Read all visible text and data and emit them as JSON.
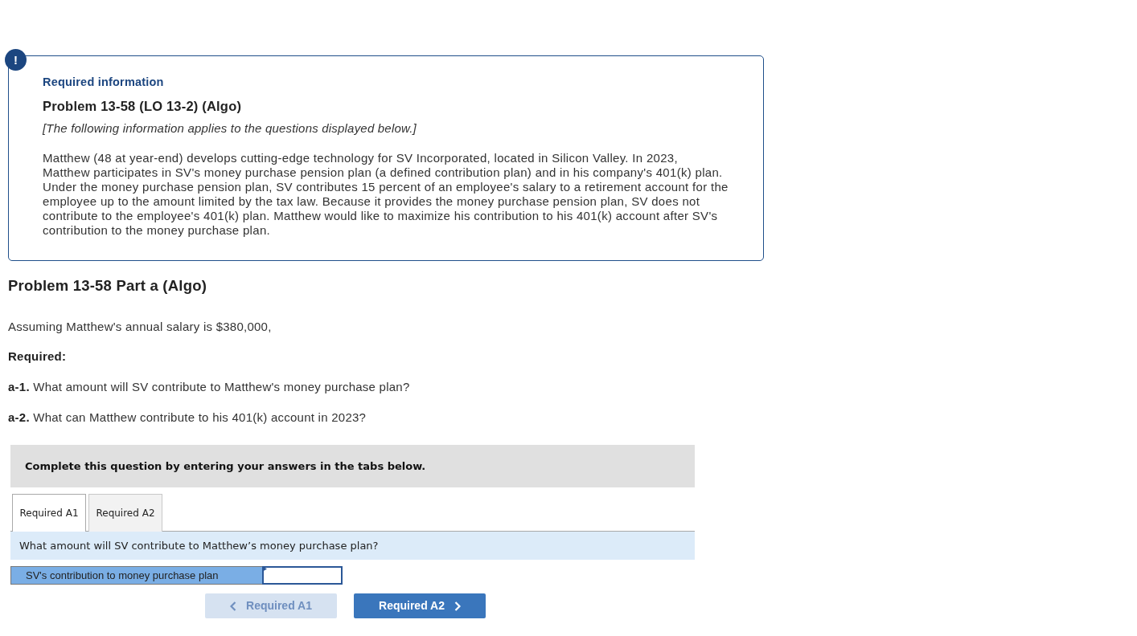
{
  "alert_icon": "!",
  "info_box": {
    "label": "Required information",
    "title": "Problem 13-58 (LO 13-2) (Algo)",
    "note": "[The following information applies to the questions displayed below.]",
    "body": "Matthew (48 at year-end) develops cutting-edge technology for SV Incorporated, located in Silicon Valley. In 2023, Matthew participates in SV's money purchase pension plan (a defined contribution plan) and in his company's 401(k) plan. Under the money purchase pension plan, SV contributes 15 percent of an employee's salary to a retirement account for the employee up to the amount limited by the tax law. Because it provides the money purchase pension plan, SV does not contribute to the employee's 401(k) plan. Matthew would like to maximize his contribution to his 401(k) account after SV's contribution to the money purchase plan."
  },
  "part": {
    "title": "Problem 13-58 Part a (Algo)",
    "intro": "Assuming Matthew's annual salary is $380,000,",
    "required_label": "Required:",
    "questions": [
      "**a-1.** What amount will SV contribute to Matthew's money purchase plan?",
      "**a-2.** What can Matthew contribute to his 401(k) account in 2023?"
    ]
  },
  "instructions": "Complete this question by entering your answers in the tabs below.",
  "tabs": [
    {
      "label": "Required A1",
      "selected": true
    },
    {
      "label": "Required A2",
      "selected": false
    }
  ],
  "question": "What amount will SV contribute to Matthew’s money purchase plan?",
  "answer_rows": [
    {
      "label": "SV's contribution to money purchase plan"
    }
  ],
  "nav_buttons": [
    {
      "kind": "prev",
      "label": "Required A1",
      "disabled": true
    },
    {
      "kind": "next",
      "label": "Required A2",
      "disabled": false
    }
  ]
}
